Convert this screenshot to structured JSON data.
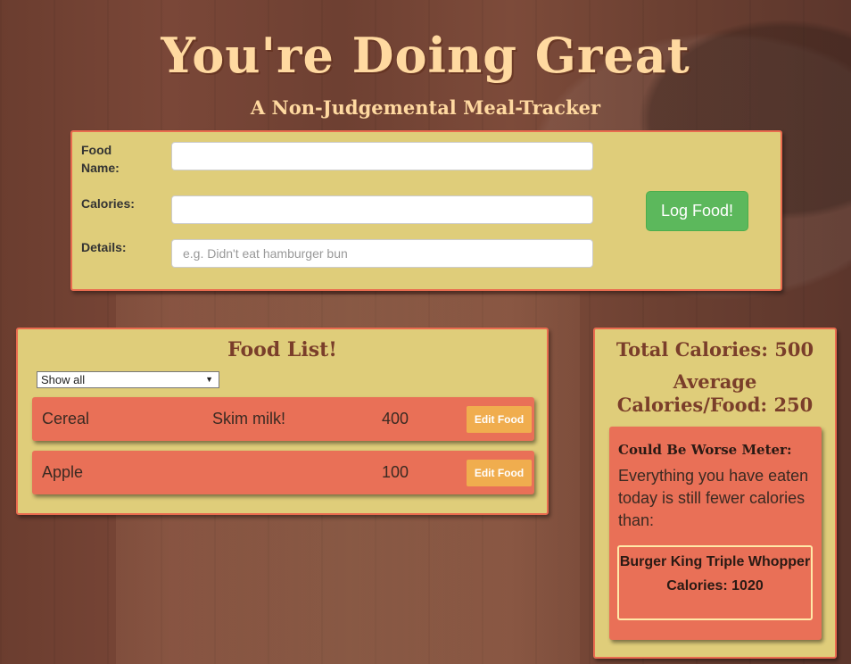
{
  "header": {
    "title": "You're Doing Great",
    "subtitle": "A Non-Judgemental Meal-Tracker"
  },
  "form": {
    "food_name_label": "Food Name:",
    "calories_label": "Calories:",
    "details_label": "Details:",
    "details_placeholder": "e.g. Didn't eat hamburger bun",
    "food_name_value": "",
    "calories_value": "",
    "details_value": "",
    "submit_label": "Log Food!"
  },
  "food_list": {
    "heading": "Food List!",
    "filter_selected": "Show all",
    "edit_label": "Edit Food",
    "items": [
      {
        "name": "Cereal",
        "details": "Skim milk!",
        "calories": "400"
      },
      {
        "name": "Apple",
        "details": "",
        "calories": "100"
      }
    ]
  },
  "stats": {
    "total_calories": "Total Calories: 500",
    "average_calories": "Average Calories/Food: 250",
    "meter_title": "Could Be Worse Meter:",
    "meter_text": "Everything you have eaten today is still fewer calories than:",
    "compare_name": "Burger King Triple Whopper",
    "compare_calories": "Calories: 1020"
  },
  "colors": {
    "panel": "#dfcd7a",
    "accent": "#e96b4f",
    "success": "#5cb85c",
    "warning": "#f0ad4e",
    "title": "#ffd9a0"
  },
  "icons": {
    "select_arrow": "dropdown-arrow-icon"
  }
}
